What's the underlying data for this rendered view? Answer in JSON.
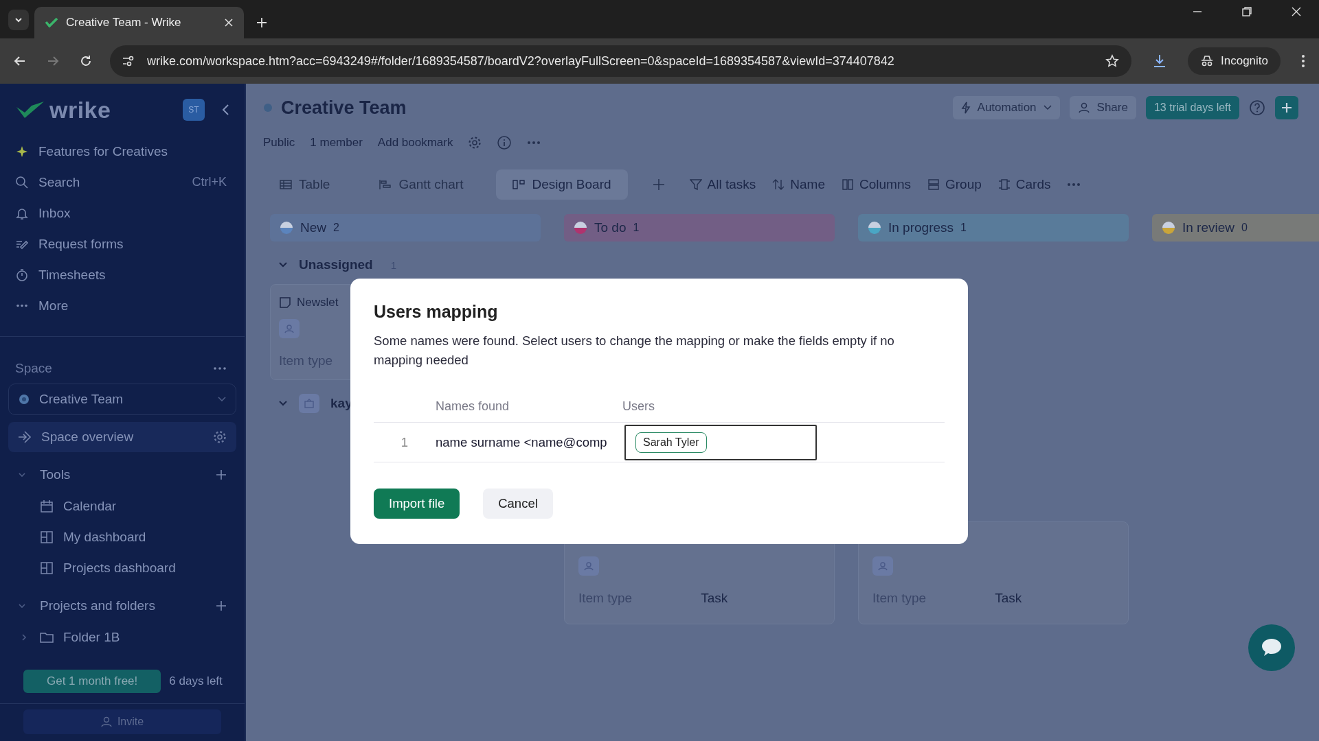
{
  "browser": {
    "tabs": [
      {
        "title": "Creative Team - Wrike",
        "selected": true
      }
    ],
    "url": "wrike.com/workspace.htm?acc=6943249#/folder/1689354587/boardV2?overlayFullScreen=0&spaceId=1689354587&viewId=374407842",
    "profile": "Incognito"
  },
  "sidebar": {
    "logo": "wrike",
    "avatar": "ST",
    "nav": [
      {
        "kind": "sparkle",
        "label": "Features for Creatives"
      },
      {
        "kind": "search",
        "label": "Search",
        "shortcut": "Ctrl+K"
      },
      {
        "kind": "bell",
        "label": "Inbox"
      },
      {
        "kind": "form",
        "label": "Request forms"
      },
      {
        "kind": "timer",
        "label": "Timesheets"
      },
      {
        "kind": "more",
        "label": "More"
      }
    ],
    "space_label": "Space",
    "space": "Creative Team",
    "space_overview": "Space overview",
    "sections": [
      {
        "label": "Tools",
        "expanded": true,
        "children": [
          {
            "kind": "calendar",
            "label": "Calendar"
          },
          {
            "kind": "dashboard",
            "label": "My dashboard"
          },
          {
            "kind": "dashboard",
            "label": "Projects dashboard"
          }
        ]
      },
      {
        "label": "Projects and folders",
        "expanded": true,
        "children": [
          {
            "kind": "folder",
            "label": "Folder 1B",
            "expanded": false
          }
        ]
      }
    ],
    "promo": {
      "button": "Get 1 month free!",
      "days_left": "6 days left"
    },
    "invite": "Invite"
  },
  "header": {
    "title": "Creative Team",
    "meta": [
      "Public",
      "1 member",
      "Add bookmark"
    ],
    "automation": "Automation",
    "share": "Share",
    "trial": "13 trial days left"
  },
  "views": [
    {
      "kind": "table",
      "label": "Table",
      "selected": false
    },
    {
      "kind": "gantt",
      "label": "Gantt chart",
      "selected": false
    },
    {
      "kind": "board",
      "label": "Design Board",
      "selected": true
    }
  ],
  "tools": [
    {
      "kind": "filter",
      "label": "All tasks"
    },
    {
      "kind": "sort",
      "label": "Name"
    },
    {
      "kind": "columns",
      "label": "Columns"
    },
    {
      "kind": "group",
      "label": "Group"
    },
    {
      "kind": "cards",
      "label": "Cards"
    }
  ],
  "columns": [
    {
      "name": "New",
      "count": "2",
      "color": "#5b84bd"
    },
    {
      "name": "To do",
      "count": "1",
      "color": "#b0336e"
    },
    {
      "name": "In progress",
      "count": "1",
      "color": "#4aa6c4"
    },
    {
      "name": "In review",
      "count": "0",
      "color": "#c9a53a"
    }
  ],
  "groups": [
    {
      "label": "Unassigned",
      "count": "1",
      "expanded": true,
      "cards": [
        {
          "kind": "first_lane",
          "title": "Newslet",
          "field": "Item type"
        }
      ]
    },
    {
      "label": "kay",
      "expanded": true,
      "cards": [
        {
          "kind": "second_lane",
          "field": "Item type",
          "value": "Task"
        },
        {
          "kind": "third_lane",
          "field": "Item type",
          "value": "Task"
        }
      ]
    }
  ],
  "modal": {
    "title": "Users mapping",
    "description": "Some names were found. Select users to change the mapping or make the fields empty if no mapping needed",
    "headers": [
      "Names found",
      "Users"
    ],
    "rows": [
      {
        "index": "1",
        "name": "name surname <name@comp",
        "user": "Sarah Tyler"
      }
    ],
    "primary": "Import file",
    "secondary": "Cancel"
  }
}
